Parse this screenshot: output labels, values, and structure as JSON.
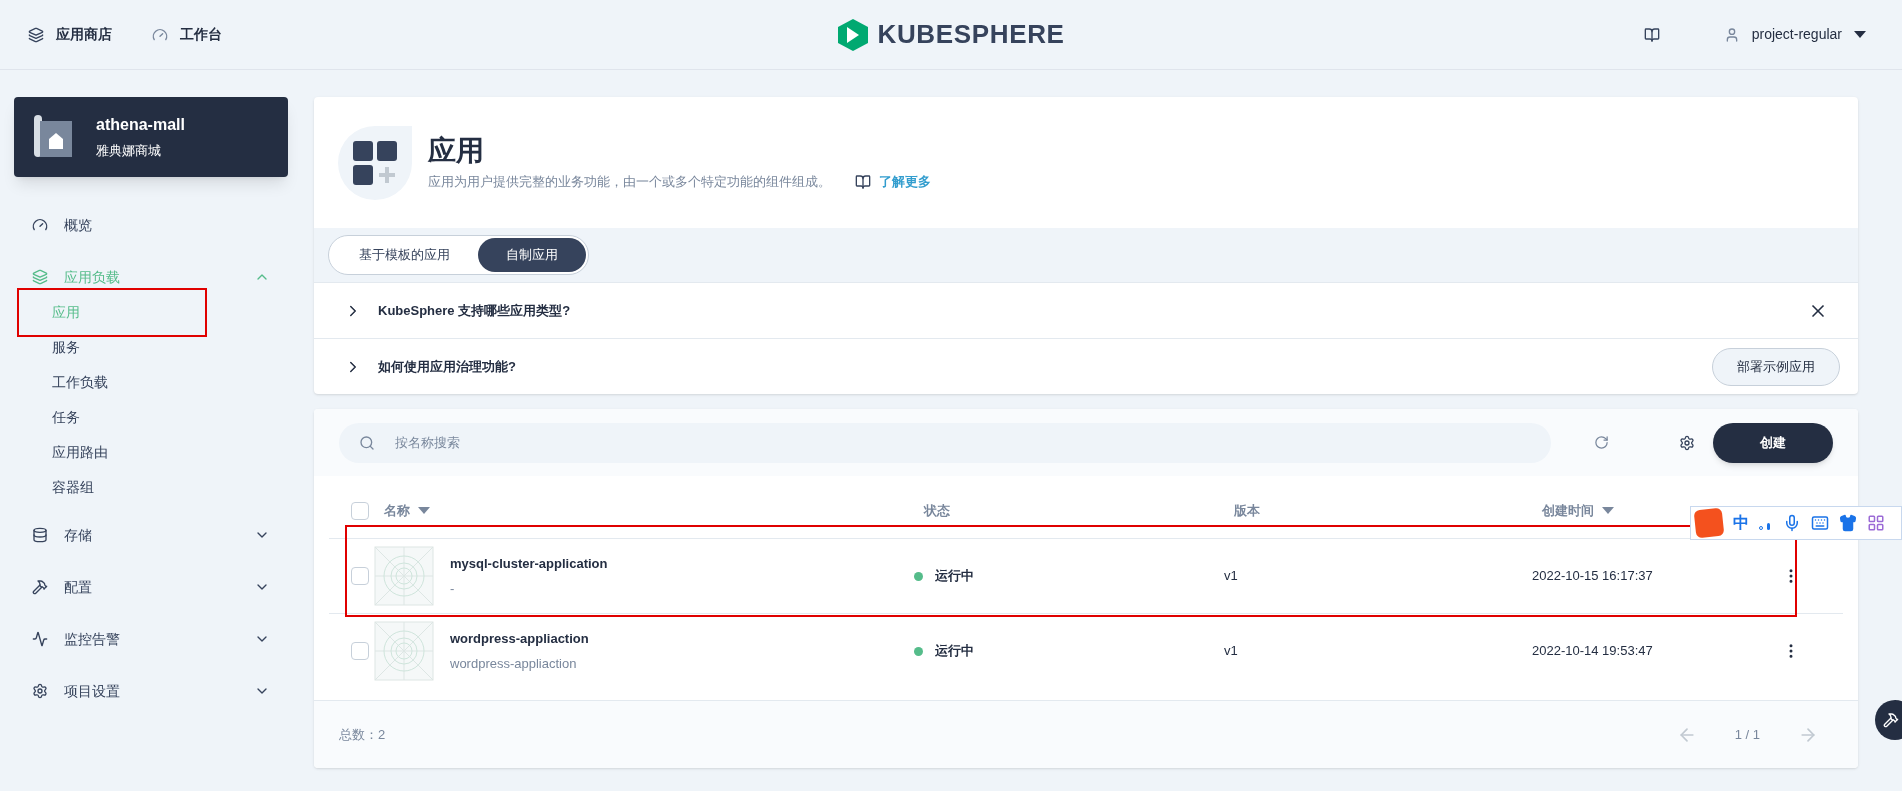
{
  "topbar": {
    "links": [
      {
        "label": "应用商店"
      },
      {
        "label": "工作台"
      }
    ],
    "logo": "KUBESPHERE",
    "user": "project-regular"
  },
  "project": {
    "name": "athena-mall",
    "alias": "雅典娜商城"
  },
  "sidebar": {
    "items": [
      {
        "label": "概览",
        "selected": false
      },
      {
        "label": "应用负载",
        "selected": true,
        "expanded": true,
        "children": [
          {
            "label": "应用",
            "selected": true
          },
          {
            "label": "服务",
            "selected": false
          },
          {
            "label": "工作负载",
            "selected": false
          },
          {
            "label": "任务",
            "selected": false
          },
          {
            "label": "应用路由",
            "selected": false
          },
          {
            "label": "容器组",
            "selected": false
          }
        ]
      },
      {
        "label": "存储",
        "selected": false,
        "expanded": false
      },
      {
        "label": "配置",
        "selected": false,
        "expanded": false
      },
      {
        "label": "监控告警",
        "selected": false,
        "expanded": false
      },
      {
        "label": "项目设置",
        "selected": false,
        "expanded": false
      }
    ]
  },
  "header": {
    "title": "应用",
    "description": "应用为用户提供完整的业务功能，由一个或多个特定功能的组件组成。",
    "learn_more": "了解更多"
  },
  "tabs": [
    {
      "label": "基于模板的应用",
      "selected": false
    },
    {
      "label": "自制应用",
      "selected": true
    }
  ],
  "faq": [
    {
      "question": "KubeSphere 支持哪些应用类型?",
      "closable": true
    },
    {
      "question": "如何使用应用治理功能?",
      "action": "部署示例应用"
    }
  ],
  "toolbar": {
    "search_placeholder": "按名称搜索",
    "create": "创建"
  },
  "table": {
    "select_all_checked": false,
    "columns": [
      {
        "label": "名称",
        "sortable": true
      },
      {
        "label": "状态"
      },
      {
        "label": "版本"
      },
      {
        "label": "创建时间",
        "sortable": true
      }
    ],
    "rows": [
      {
        "name": "mysql-cluster-application",
        "description": "-",
        "status": "运行中",
        "color": "#55bc8a",
        "version": "v1",
        "created": "2022-10-15 16:17:37",
        "checked": false
      },
      {
        "name": "wordpress-appliaction",
        "description": "wordpress-appliaction",
        "status": "运行中",
        "color": "#55bc8a",
        "version": "v1",
        "created": "2022-10-14 19:53:47",
        "checked": false
      }
    ]
  },
  "footer": {
    "total": "总数：2",
    "page": "1 / 1"
  },
  "ime_toolbar": {
    "mode": "中"
  }
}
